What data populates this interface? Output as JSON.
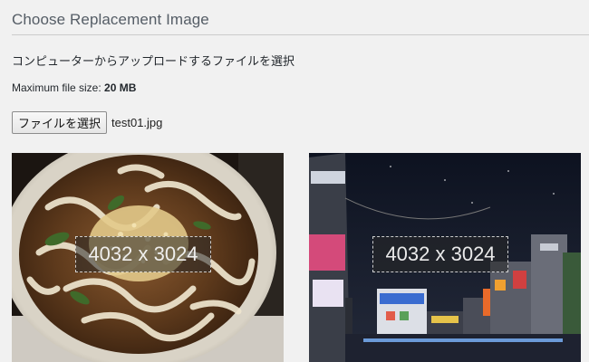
{
  "header": {
    "title": "Choose Replacement Image"
  },
  "upload": {
    "instruction": "コンピューターからアップロードするファイルを選択",
    "max_size_label": "Maximum file size:",
    "max_size_value": "20 MB",
    "choose_button_label": "ファイルを選択",
    "chosen_file": "test01.jpg"
  },
  "previews": [
    {
      "subject": "udon noodle bowl photo",
      "dimensions": "4032 x 3024"
    },
    {
      "subject": "city street at night photo",
      "dimensions": "4032 x 3024"
    }
  ],
  "colors": {
    "background": "#f1f1f1",
    "divider": "#cccccc",
    "title": "#555d66"
  }
}
